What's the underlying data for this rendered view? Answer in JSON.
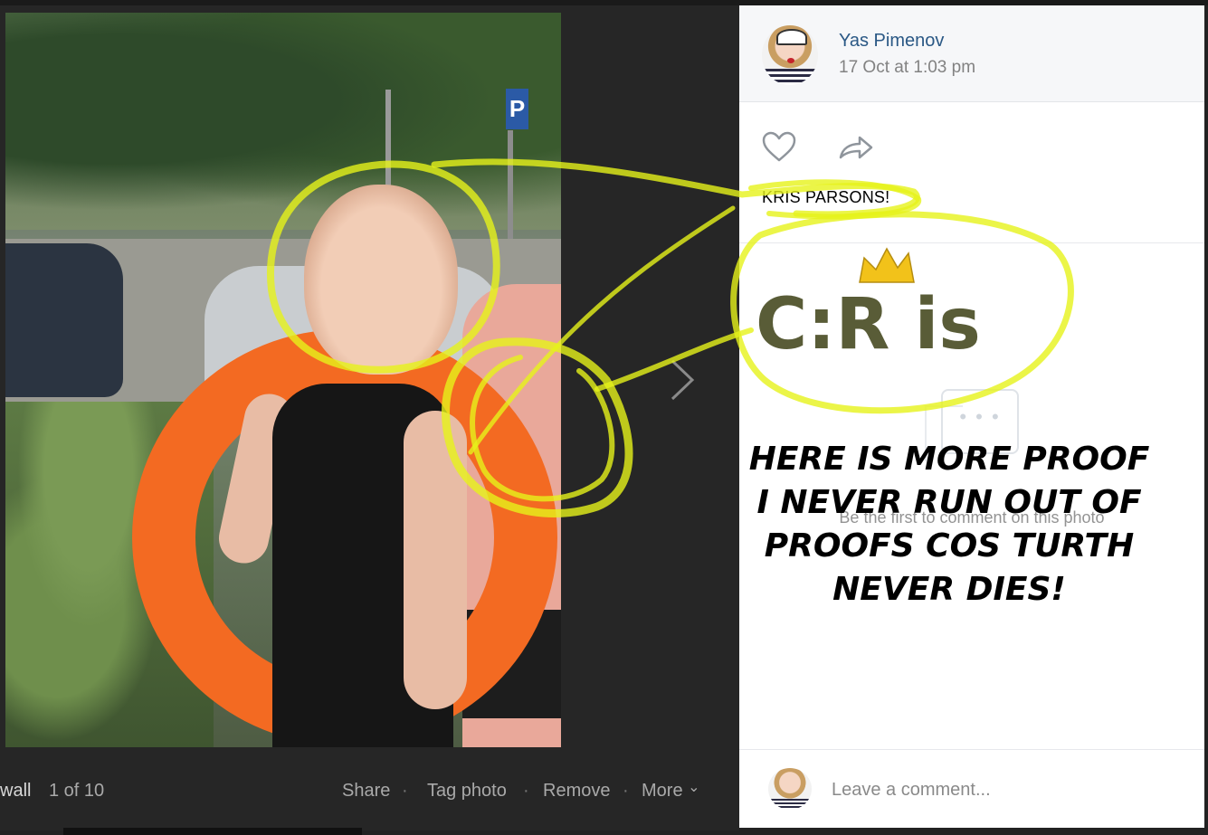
{
  "viewer": {
    "album_link": "wall",
    "counter": "1 of 10",
    "actions": {
      "share": "Share",
      "tag_photo": "Tag photo",
      "remove": "Remove",
      "more": "More"
    },
    "separator": "·",
    "more_chevron": "⌄",
    "parking_sign": "P"
  },
  "post": {
    "author": "Yas Pimenov",
    "date": "17 Oct at 1:03 pm",
    "caption": "KRIS PARSONS!",
    "no_comments_text": "Be the first to comment on this photo",
    "comment_placeholder": "Leave a comment..."
  },
  "annotation": {
    "handwriting": "C:R is",
    "meme_lines": [
      "HERE IS MORE PROOF",
      "I NEVER RUN OUT OF",
      "PROOFS COS TURTH",
      "NEVER DIES!"
    ],
    "highlight_color": "#e6f21a",
    "crown_color": "#f2c21a"
  },
  "colors": {
    "link": "#2a5885",
    "meta": "#828282",
    "background": "#222222"
  },
  "icons": {
    "like": "heart-icon",
    "share": "share-arrow-icon",
    "next": "chevron-right-icon"
  }
}
